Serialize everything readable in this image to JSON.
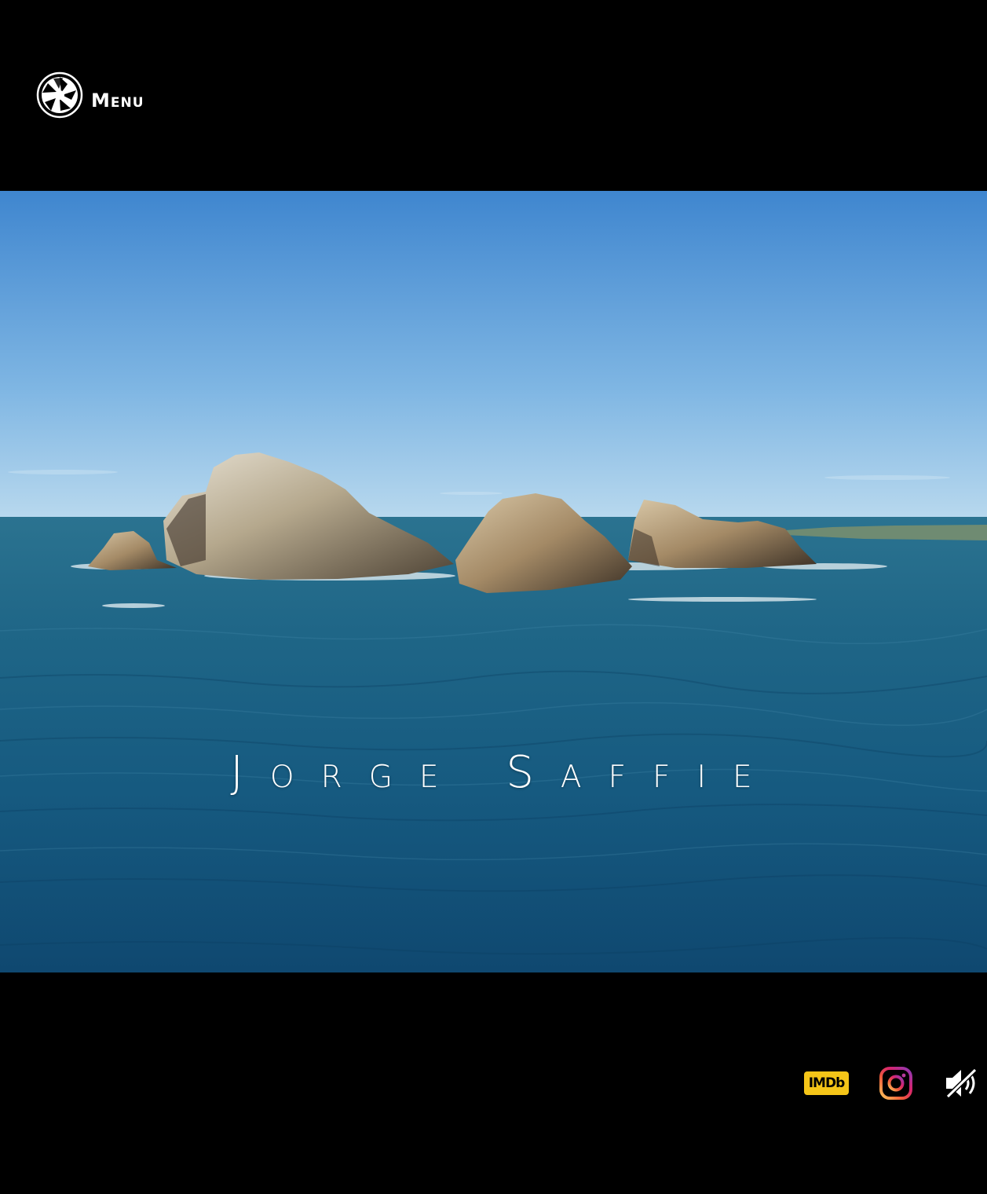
{
  "header": {
    "menu_label": "Menu",
    "logo_icon": "camera-shutter-icon"
  },
  "hero": {
    "title": "Jorge Saffie",
    "background": "aerial-video-sea-rocks"
  },
  "footer": {
    "imdb_label": "IMDb",
    "imdb_color": "#f5c518",
    "instagram_icon": "instagram-icon",
    "sound_icon": "speaker-muted-icon"
  }
}
